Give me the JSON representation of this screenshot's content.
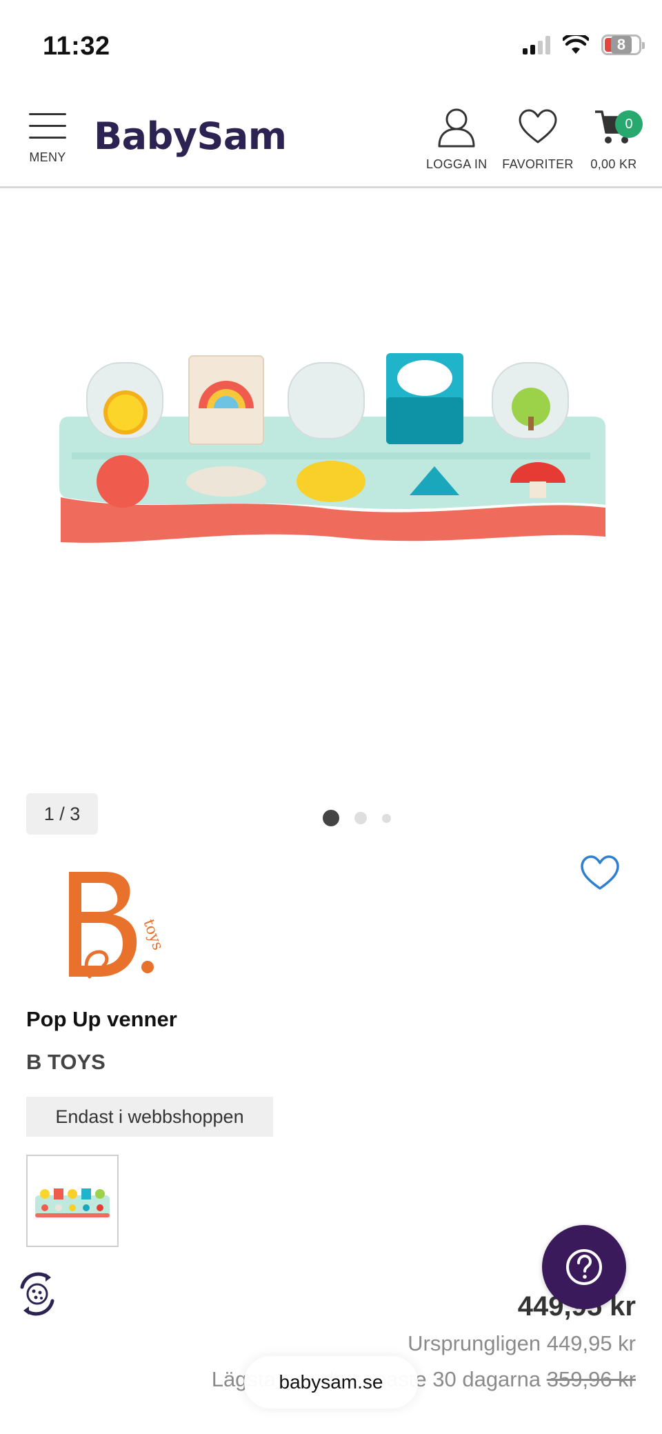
{
  "status_bar": {
    "time": "11:32",
    "battery": "8"
  },
  "header": {
    "logo": "BabySam",
    "menu_label": "MENY",
    "login_label": "LOGGA IN",
    "favorites_label": "FAVORITER",
    "cart_total": "0,00 KR",
    "cart_count": "0"
  },
  "gallery": {
    "counter": "1 / 3",
    "slides": 3,
    "active_slide": 1
  },
  "product": {
    "brand_logo_text": "B. toys",
    "title": "Pop Up venner",
    "brand": "B TOYS",
    "availability_badge": "Endast i webbshoppen",
    "price": "449,95 kr",
    "original_price": "Ursprungligen 449,95 kr",
    "lowest_price_text": "Lägsta pris de senaste 30 dagarna",
    "lowest_price_value": "359,96 kr"
  },
  "browser": {
    "url": "babysam.se"
  },
  "colors": {
    "brand_purple": "#2c2352",
    "cart_badge_green": "#27a86e",
    "help_button_purple": "#3b1a5c",
    "wishlist_blue": "#2f7fd1"
  },
  "icons": [
    "menu-icon",
    "user-icon",
    "heart-icon",
    "cart-icon",
    "question-icon",
    "cookie-icon"
  ]
}
